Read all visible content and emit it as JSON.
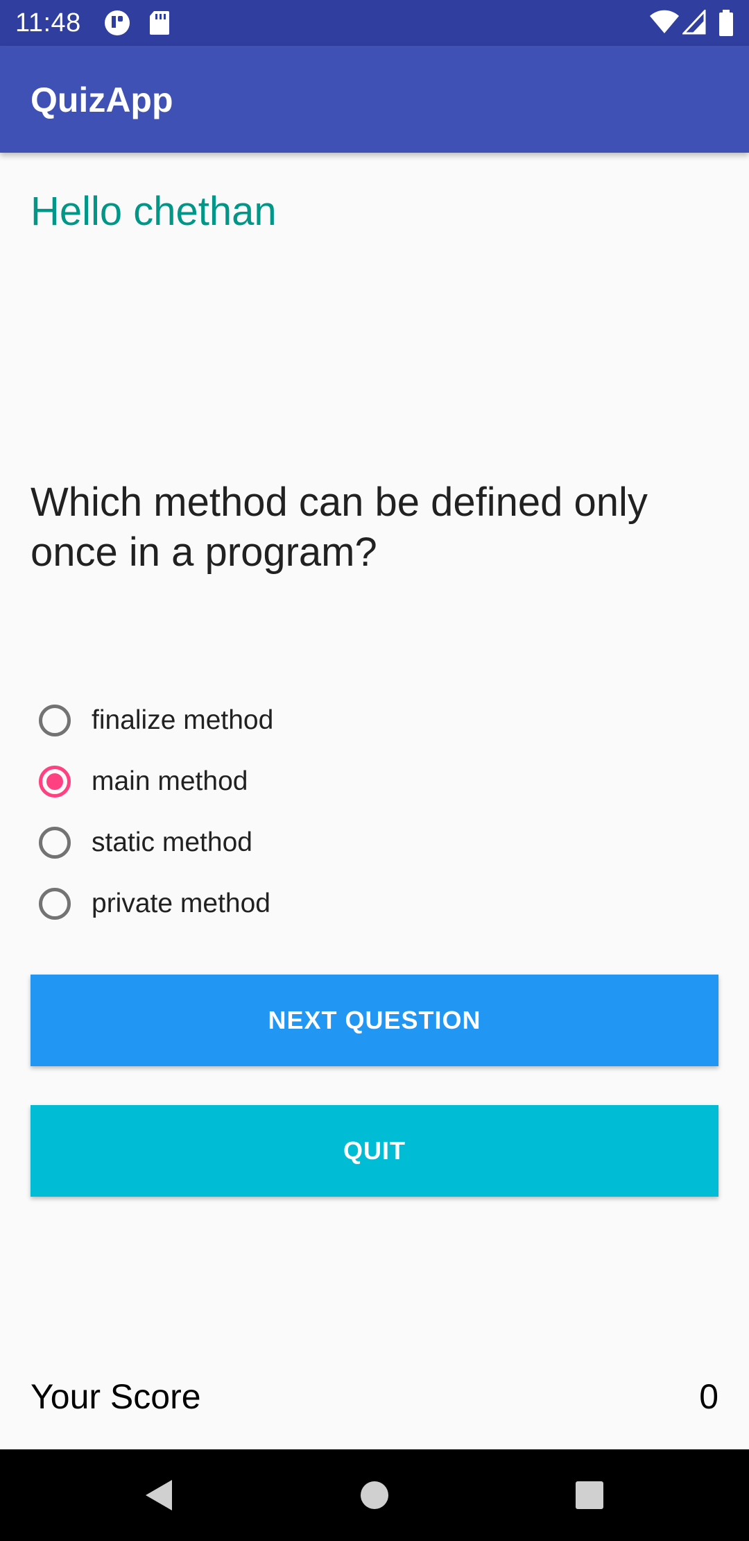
{
  "status_bar": {
    "time": "11:48",
    "left_icons": [
      "notification-badge-icon",
      "sd-card-icon"
    ],
    "right_icons": [
      "wifi-icon",
      "cell-signal-icon",
      "battery-icon"
    ],
    "background": "#303f9f"
  },
  "app_bar": {
    "title": "QuizApp",
    "background": "#3f51b5"
  },
  "greeting": "Hello chethan",
  "question": "Which method can be defined only once in a program?",
  "options": [
    {
      "label": "finalize method",
      "selected": false
    },
    {
      "label": "main method",
      "selected": true
    },
    {
      "label": "static method",
      "selected": false
    },
    {
      "label": "private method",
      "selected": false
    }
  ],
  "buttons": {
    "next_label": "NEXT QUESTION",
    "quit_label": "QUIT"
  },
  "score": {
    "label": "Your Score",
    "value": "0"
  },
  "nav_bar": {
    "buttons": [
      "back-icon",
      "home-icon",
      "recents-icon"
    ]
  },
  "colors": {
    "accent": "#ff4081",
    "greeting": "#009688",
    "next_button": "#2196f3",
    "quit_button": "#00bcd4"
  }
}
